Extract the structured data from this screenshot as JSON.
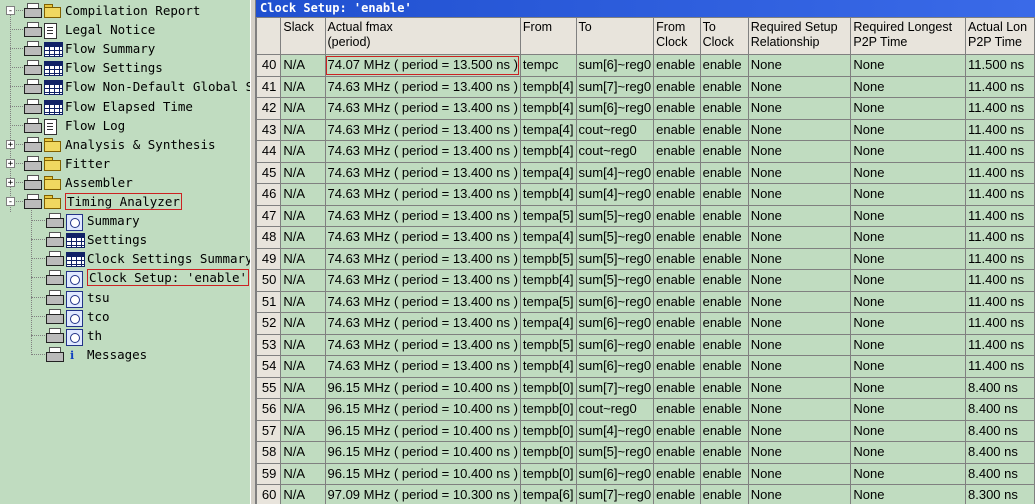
{
  "tree": {
    "items": [
      {
        "label": "Compilation Report",
        "icon": "folder-icon",
        "printer": true,
        "expander": "-"
      },
      {
        "label": "Legal Notice",
        "icon": "document-icon",
        "printer": true
      },
      {
        "label": "Flow Summary",
        "icon": "table-icon",
        "printer": true
      },
      {
        "label": "Flow Settings",
        "icon": "table-icon",
        "printer": true
      },
      {
        "label": "Flow Non-Default Global S",
        "icon": "table-icon",
        "printer": true
      },
      {
        "label": "Flow Elapsed Time",
        "icon": "table-icon",
        "printer": true
      },
      {
        "label": "Flow Log",
        "icon": "document-icon",
        "printer": true
      },
      {
        "label": "Analysis & Synthesis",
        "icon": "folder-icon",
        "printer": true,
        "expander": "+"
      },
      {
        "label": "Fitter",
        "icon": "folder-icon",
        "printer": true,
        "expander": "+"
      },
      {
        "label": "Assembler",
        "icon": "folder-icon",
        "printer": true,
        "expander": "+"
      },
      {
        "label": "Timing Analyzer",
        "icon": "folder-icon",
        "printer": true,
        "expander": "-",
        "highlight": true
      },
      {
        "label": "Summary",
        "icon": "clock-table-icon",
        "printer": true,
        "child": true
      },
      {
        "label": "Settings",
        "icon": "table-icon",
        "printer": true,
        "child": true
      },
      {
        "label": "Clock Settings Summary",
        "icon": "table-icon",
        "printer": true,
        "child": true
      },
      {
        "label": "Clock Setup: 'enable'",
        "icon": "clock-table-icon",
        "printer": true,
        "child": true,
        "highlight": true
      },
      {
        "label": "tsu",
        "icon": "clock-table-icon",
        "printer": true,
        "child": true
      },
      {
        "label": "tco",
        "icon": "clock-table-icon",
        "printer": true,
        "child": true
      },
      {
        "label": "th",
        "icon": "clock-table-icon",
        "printer": true,
        "child": true
      },
      {
        "label": "Messages",
        "icon": "info-icon",
        "printer": true,
        "child": true
      }
    ]
  },
  "panel": {
    "title": "Clock Setup: 'enable'"
  },
  "table": {
    "headers": [
      "",
      "Slack",
      "Actual fmax\n(period)",
      "From",
      "To",
      "From\nClock",
      "To\nClock",
      "Required Setup\nRelationship",
      "Required Longest\nP2P Time",
      "Actual Lon\nP2P Time"
    ],
    "rows": [
      [
        "40",
        "N/A",
        "74.07 MHz ( period = 13.500 ns )",
        "tempc",
        "sum[6]~reg0",
        "enable",
        "enable",
        "None",
        "None",
        "11.500 ns"
      ],
      [
        "41",
        "N/A",
        "74.63 MHz ( period = 13.400 ns )",
        "tempb[4]",
        "sum[7]~reg0",
        "enable",
        "enable",
        "None",
        "None",
        "11.400 ns"
      ],
      [
        "42",
        "N/A",
        "74.63 MHz ( period = 13.400 ns )",
        "tempb[4]",
        "sum[6]~reg0",
        "enable",
        "enable",
        "None",
        "None",
        "11.400 ns"
      ],
      [
        "43",
        "N/A",
        "74.63 MHz ( period = 13.400 ns )",
        "tempa[4]",
        "cout~reg0",
        "enable",
        "enable",
        "None",
        "None",
        "11.400 ns"
      ],
      [
        "44",
        "N/A",
        "74.63 MHz ( period = 13.400 ns )",
        "tempb[4]",
        "cout~reg0",
        "enable",
        "enable",
        "None",
        "None",
        "11.400 ns"
      ],
      [
        "45",
        "N/A",
        "74.63 MHz ( period = 13.400 ns )",
        "tempa[4]",
        "sum[4]~reg0",
        "enable",
        "enable",
        "None",
        "None",
        "11.400 ns"
      ],
      [
        "46",
        "N/A",
        "74.63 MHz ( period = 13.400 ns )",
        "tempb[4]",
        "sum[4]~reg0",
        "enable",
        "enable",
        "None",
        "None",
        "11.400 ns"
      ],
      [
        "47",
        "N/A",
        "74.63 MHz ( period = 13.400 ns )",
        "tempa[5]",
        "sum[5]~reg0",
        "enable",
        "enable",
        "None",
        "None",
        "11.400 ns"
      ],
      [
        "48",
        "N/A",
        "74.63 MHz ( period = 13.400 ns )",
        "tempa[4]",
        "sum[5]~reg0",
        "enable",
        "enable",
        "None",
        "None",
        "11.400 ns"
      ],
      [
        "49",
        "N/A",
        "74.63 MHz ( period = 13.400 ns )",
        "tempb[5]",
        "sum[5]~reg0",
        "enable",
        "enable",
        "None",
        "None",
        "11.400 ns"
      ],
      [
        "50",
        "N/A",
        "74.63 MHz ( period = 13.400 ns )",
        "tempb[4]",
        "sum[5]~reg0",
        "enable",
        "enable",
        "None",
        "None",
        "11.400 ns"
      ],
      [
        "51",
        "N/A",
        "74.63 MHz ( period = 13.400 ns )",
        "tempa[5]",
        "sum[6]~reg0",
        "enable",
        "enable",
        "None",
        "None",
        "11.400 ns"
      ],
      [
        "52",
        "N/A",
        "74.63 MHz ( period = 13.400 ns )",
        "tempa[4]",
        "sum[6]~reg0",
        "enable",
        "enable",
        "None",
        "None",
        "11.400 ns"
      ],
      [
        "53",
        "N/A",
        "74.63 MHz ( period = 13.400 ns )",
        "tempb[5]",
        "sum[6]~reg0",
        "enable",
        "enable",
        "None",
        "None",
        "11.400 ns"
      ],
      [
        "54",
        "N/A",
        "74.63 MHz ( period = 13.400 ns )",
        "tempb[4]",
        "sum[6]~reg0",
        "enable",
        "enable",
        "None",
        "None",
        "11.400 ns"
      ],
      [
        "55",
        "N/A",
        "96.15 MHz ( period = 10.400 ns )",
        "tempb[0]",
        "sum[7]~reg0",
        "enable",
        "enable",
        "None",
        "None",
        "8.400 ns"
      ],
      [
        "56",
        "N/A",
        "96.15 MHz ( period = 10.400 ns )",
        "tempb[0]",
        "cout~reg0",
        "enable",
        "enable",
        "None",
        "None",
        "8.400 ns"
      ],
      [
        "57",
        "N/A",
        "96.15 MHz ( period = 10.400 ns )",
        "tempb[0]",
        "sum[4]~reg0",
        "enable",
        "enable",
        "None",
        "None",
        "8.400 ns"
      ],
      [
        "58",
        "N/A",
        "96.15 MHz ( period = 10.400 ns )",
        "tempb[0]",
        "sum[5]~reg0",
        "enable",
        "enable",
        "None",
        "None",
        "8.400 ns"
      ],
      [
        "59",
        "N/A",
        "96.15 MHz ( period = 10.400 ns )",
        "tempb[0]",
        "sum[6]~reg0",
        "enable",
        "enable",
        "None",
        "None",
        "8.400 ns"
      ],
      [
        "60",
        "N/A",
        "97.09 MHz ( period = 10.300 ns )",
        "tempa[6]",
        "sum[7]~reg0",
        "enable",
        "enable",
        "None",
        "None",
        "8.300 ns"
      ]
    ],
    "highlight_row": 0,
    "highlight_col": 2
  },
  "colors": {
    "background": "#c0dcc0",
    "title_bar": "#2050d0",
    "highlight_border": "#cc2222",
    "header_bg": "#e8e4dc"
  }
}
